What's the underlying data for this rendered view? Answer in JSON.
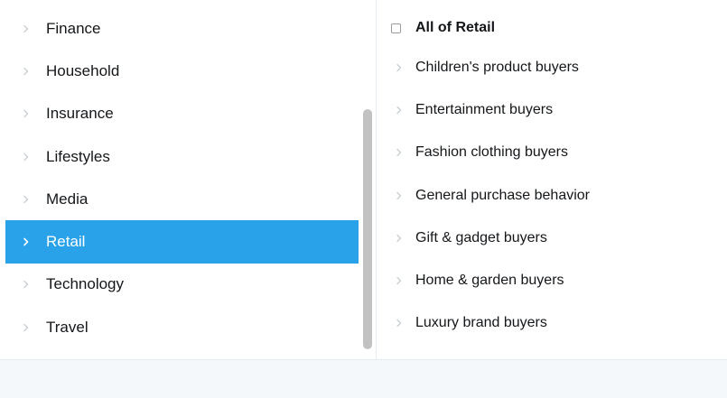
{
  "colors": {
    "accent": "#2aa2e9",
    "chevron": "#c8ced3",
    "chevron_active": "#ffffff",
    "divider": "#e6ecf0",
    "footer_bg": "#f5f8fa",
    "scroll_thumb": "#c2c2c2"
  },
  "categories": {
    "items": [
      {
        "label": "Finance",
        "icon": "chevron-right-icon"
      },
      {
        "label": "Household",
        "icon": "chevron-right-icon"
      },
      {
        "label": "Insurance",
        "icon": "chevron-right-icon"
      },
      {
        "label": "Lifestyles",
        "icon": "chevron-right-icon"
      },
      {
        "label": "Media",
        "icon": "chevron-right-icon"
      },
      {
        "label": "Retail",
        "icon": "chevron-right-icon",
        "selected": true
      },
      {
        "label": "Technology",
        "icon": "chevron-right-icon"
      },
      {
        "label": "Travel",
        "icon": "chevron-right-icon"
      }
    ]
  },
  "subcategories": {
    "all_label": "All of Retail",
    "all_checked": false,
    "items": [
      {
        "label": "Children's product buyers",
        "icon": "chevron-right-icon"
      },
      {
        "label": "Entertainment buyers",
        "icon": "chevron-right-icon"
      },
      {
        "label": "Fashion clothing buyers",
        "icon": "chevron-right-icon"
      },
      {
        "label": "General purchase behavior",
        "icon": "chevron-right-icon"
      },
      {
        "label": "Gift & gadget buyers",
        "icon": "chevron-right-icon"
      },
      {
        "label": "Home & garden buyers",
        "icon": "chevron-right-icon"
      },
      {
        "label": "Luxury brand buyers",
        "icon": "chevron-right-icon"
      }
    ]
  }
}
